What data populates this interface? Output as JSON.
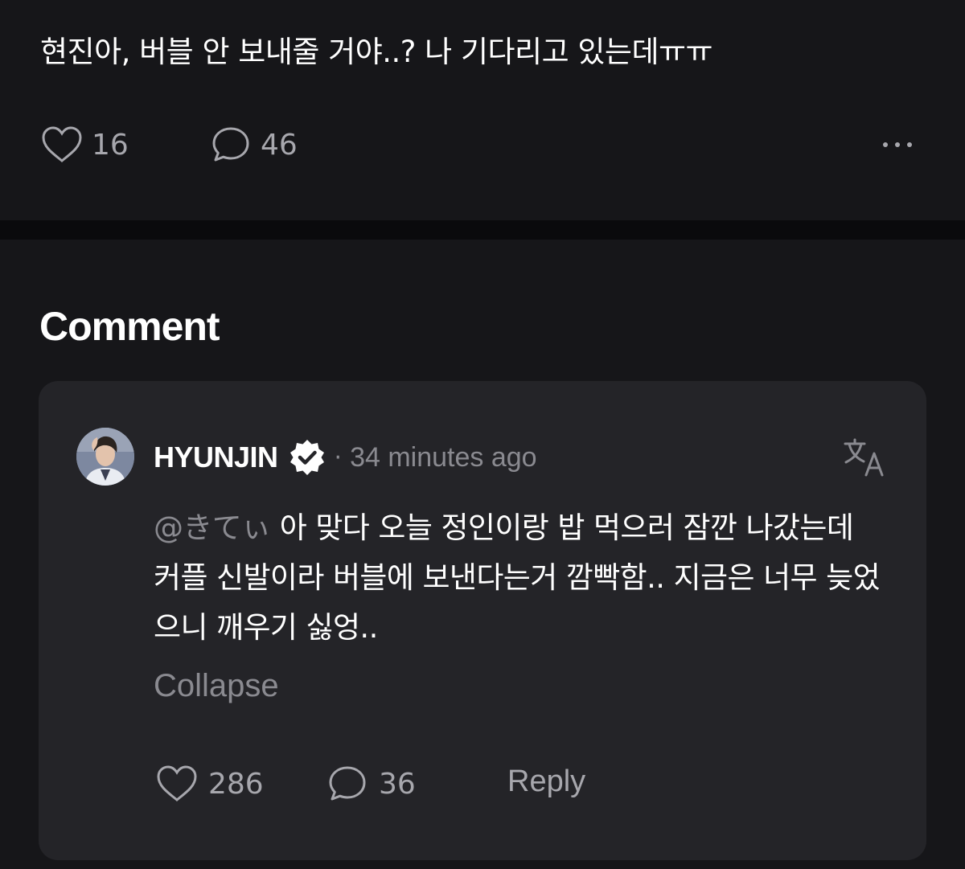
{
  "post": {
    "text": "현진아, 버블 안 보내줄 거야..? 나 기다리고 있는데ㅠㅠ",
    "likes": "16",
    "comments": "46",
    "icons": {
      "like": "heart-icon",
      "comment": "speech-bubble-icon",
      "more": "more-dots-icon"
    }
  },
  "comments_section": {
    "title": "Comment",
    "comment": {
      "author": "HYUNJIN",
      "separator": "·",
      "time": "34 minutes ago",
      "mention": "@きてぃ",
      "body": " 아 맞다 오늘 정인이랑 밥 먹으러 잠깐 나갔는데 커플 신발이라 버블에 보낸다는거 깜빡함.. 지금은 너무 늦었으니 깨우기 싫엉..",
      "collapse_label": "Collapse",
      "likes": "286",
      "replies": "36",
      "reply_label": "Reply",
      "icons": {
        "avatar": "avatar",
        "verified": "verified-badge-icon",
        "translate": "translate-icon"
      }
    }
  },
  "colors": {
    "background": "#0a0a0c",
    "surface": "#161619",
    "card": "#242428",
    "text": "#ffffff",
    "muted": "#8a8a90"
  }
}
